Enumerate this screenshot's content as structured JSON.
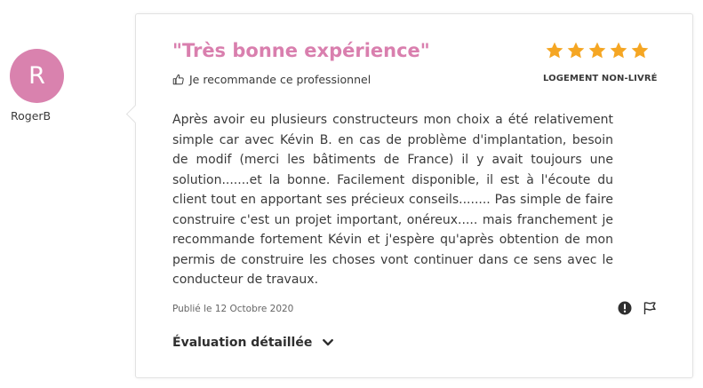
{
  "reviewer": {
    "initial": "R",
    "name": "RogerB",
    "avatar_color": "#d982ae"
  },
  "review": {
    "title": "\"Très bonne expérience\"",
    "recommend_text": "Je recommande ce professionnel",
    "recommend_icon": "thumbs-up-icon",
    "rating": 5,
    "rating_max": 5,
    "star_color": "#f5a623",
    "housing_type": "LOGEMENT NON-LIVRÉ",
    "body": "Après avoir eu plusieurs constructeurs mon choix a été relativement simple car avec Kévin B. en cas de problème d'implantation, besoin de modif (merci les bâtiments de France) il y avait toujours une solution.......et la bonne. Facilement disponible, il est à l'écoute du client tout en apportant ses précieux conseils........ Pas simple de faire construire c'est un projet important, onéreux..... mais franchement je recommande fortement Kévin et j'espère qu'après obtention de mon permis de construire les choses vont continuer dans ce sens avec le conducteur de travaux.",
    "published": "Publié le 12 Octobre 2020",
    "details_label": "Évaluation détaillée",
    "title_color": "#d97fae"
  },
  "actions": {
    "report_icon": "exclamation-circle-icon",
    "flag_icon": "flag-icon"
  }
}
